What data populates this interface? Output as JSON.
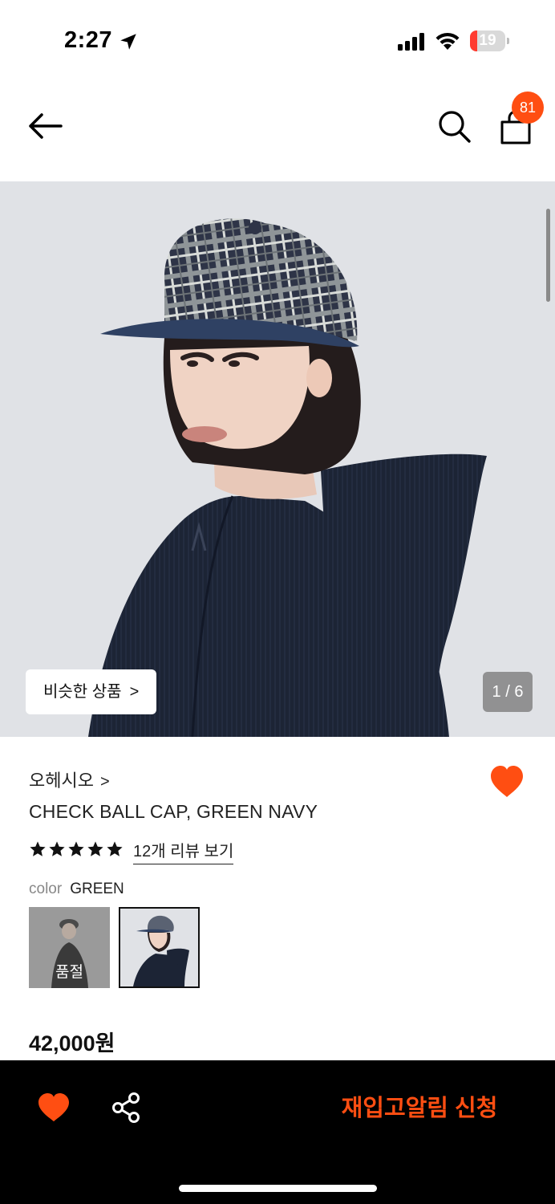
{
  "status_bar": {
    "time": "2:27",
    "battery": "19"
  },
  "nav": {
    "cart_count": "81"
  },
  "hero": {
    "similar_label": "비슷한 상품",
    "similar_chevron": ">",
    "counter": "1 / 6"
  },
  "product": {
    "brand": "오헤시오",
    "brand_chevron": ">",
    "title": "CHECK BALL CAP, GREEN NAVY",
    "rating_stars": 5,
    "review_link": "12개 리뷰 보기",
    "color_label": "color",
    "color_value": "GREEN",
    "swatches": [
      {
        "status": "품절"
      },
      {
        "status": ""
      }
    ],
    "price": "42,000원"
  },
  "bottom_bar": {
    "restock_label": "재입고알림 신청"
  },
  "colors": {
    "accent": "#ff4e12",
    "bottom_bar_bg": "#000000"
  },
  "icons": [
    "location-arrow-icon",
    "signal-icon",
    "wifi-icon",
    "battery-icon",
    "back-arrow-icon",
    "search-icon",
    "shopping-bag-icon",
    "heart-icon",
    "star-icon",
    "share-icon"
  ]
}
